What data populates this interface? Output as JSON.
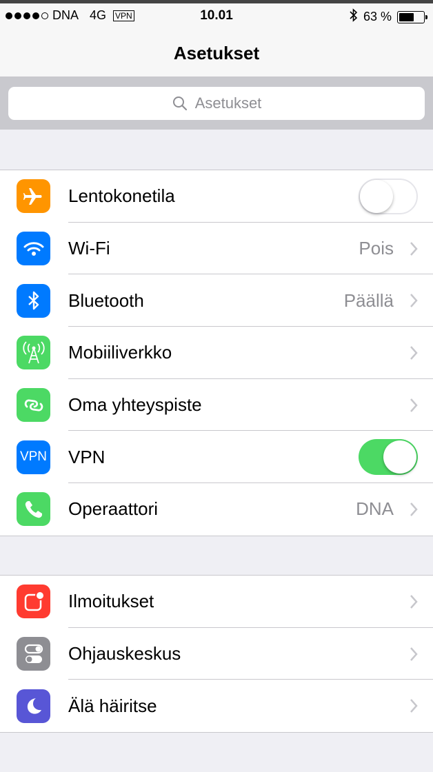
{
  "status_bar": {
    "carrier": "DNA",
    "network": "4G",
    "vpn_badge": "VPN",
    "time": "10.01",
    "battery_text": "63 %",
    "battery_level": 0.63
  },
  "nav": {
    "title": "Asetukset"
  },
  "search": {
    "placeholder": "Asetukset"
  },
  "group1": [
    {
      "label": "Lentokonetila",
      "icon": "airplane-icon",
      "color": "#ff9500",
      "toggle": false
    },
    {
      "label": "Wi-Fi",
      "icon": "wifi-icon",
      "color": "#007aff",
      "value": "Pois"
    },
    {
      "label": "Bluetooth",
      "icon": "bluetooth-icon",
      "color": "#007aff",
      "value": "Päällä"
    },
    {
      "label": "Mobiiliverkko",
      "icon": "cellular-antenna-icon",
      "color": "#4cd964",
      "value": ""
    },
    {
      "label": "Oma yhteyspiste",
      "icon": "hotspot-icon",
      "color": "#4cd964",
      "value": ""
    },
    {
      "label": "VPN",
      "icon": "vpn-icon",
      "icon_text": "VPN",
      "color": "#007aff",
      "toggle": true
    },
    {
      "label": "Operaattori",
      "icon": "phone-icon",
      "color": "#4cd964",
      "value": "DNA"
    }
  ],
  "group2": [
    {
      "label": "Ilmoitukset",
      "icon": "notifications-icon",
      "color": "#ff3b30",
      "value": ""
    },
    {
      "label": "Ohjauskeskus",
      "icon": "control-center-icon",
      "color": "#8e8e93",
      "value": ""
    },
    {
      "label": "Älä häiritse",
      "icon": "moon-icon",
      "color": "#5856d6",
      "value": ""
    }
  ]
}
